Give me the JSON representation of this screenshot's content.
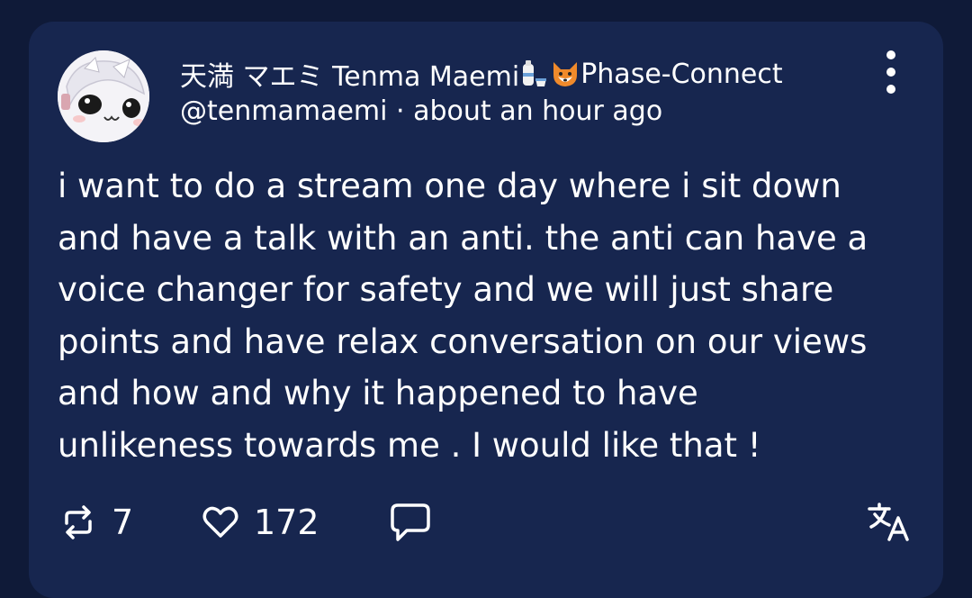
{
  "post": {
    "display_name": "天満 マエミ Tenma Maemi",
    "name_suffix": "Phase-Connect",
    "handle": "@tenmamaemi",
    "separator": "·",
    "timestamp": "about an hour ago",
    "body": "i want to do a stream one day where i sit down\nand have a talk with an anti. the anti  can have a\nvoice changer for safety and we will just share\npoints and have relax conversation on our views\nand how and why it happened to have\nunlikeness towards me . I would like that !",
    "name_emojis": [
      "sake-emoji",
      "fox-emoji"
    ]
  },
  "actions": {
    "repost_count": "7",
    "like_count": "172",
    "icons": [
      "repost-icon",
      "heart-icon",
      "reply-icon",
      "translate-icon",
      "more-vertical-icon"
    ]
  },
  "colors": {
    "background": "#0f1a38",
    "card": "#17264f",
    "text": "#ffffff"
  }
}
